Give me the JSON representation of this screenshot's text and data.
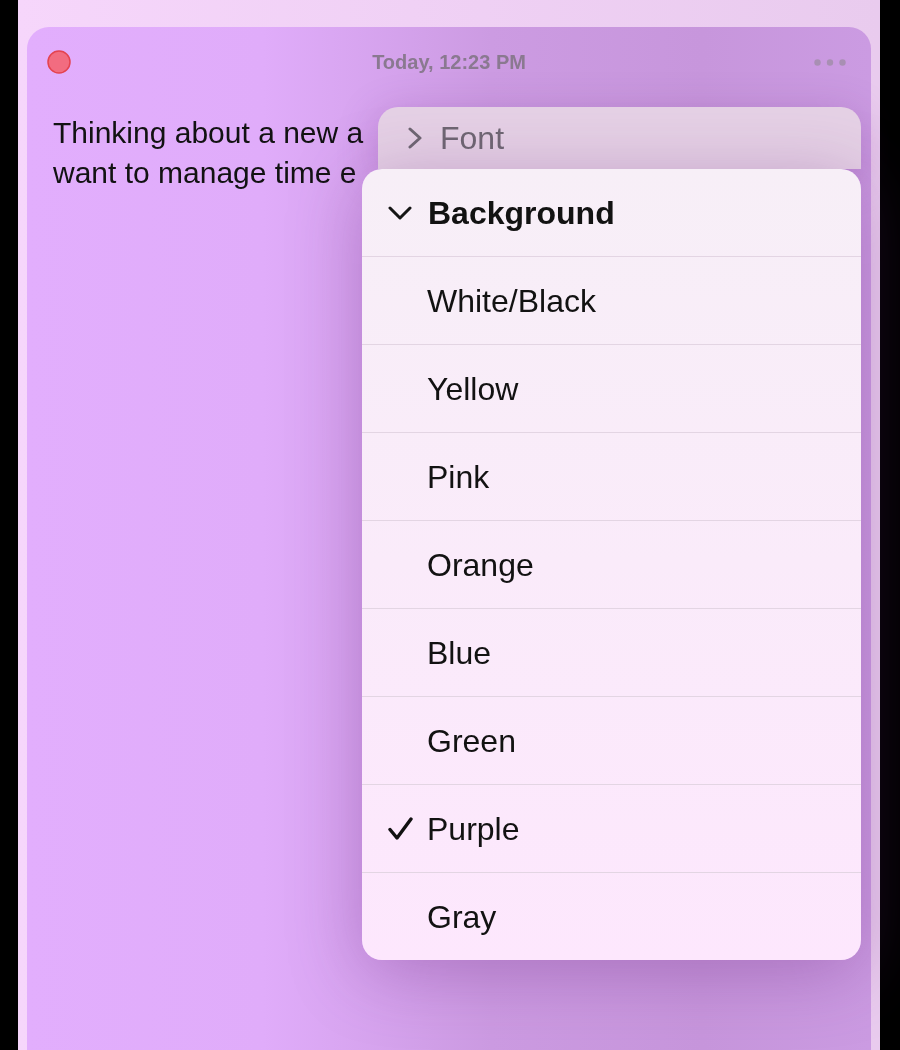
{
  "window": {
    "title": "Today, 12:23 PM"
  },
  "note": {
    "lines": [
      "Thinking about a new a",
      "want to manage time e"
    ]
  },
  "menu": {
    "sections": [
      {
        "label": "Font",
        "expanded": false
      },
      {
        "label": "Background",
        "expanded": true,
        "options": [
          {
            "label": "White/Black",
            "selected": false
          },
          {
            "label": "Yellow",
            "selected": false
          },
          {
            "label": "Pink",
            "selected": false
          },
          {
            "label": "Orange",
            "selected": false
          },
          {
            "label": "Blue",
            "selected": false
          },
          {
            "label": "Green",
            "selected": false
          },
          {
            "label": "Purple",
            "selected": true
          },
          {
            "label": "Gray",
            "selected": false
          }
        ]
      }
    ]
  }
}
